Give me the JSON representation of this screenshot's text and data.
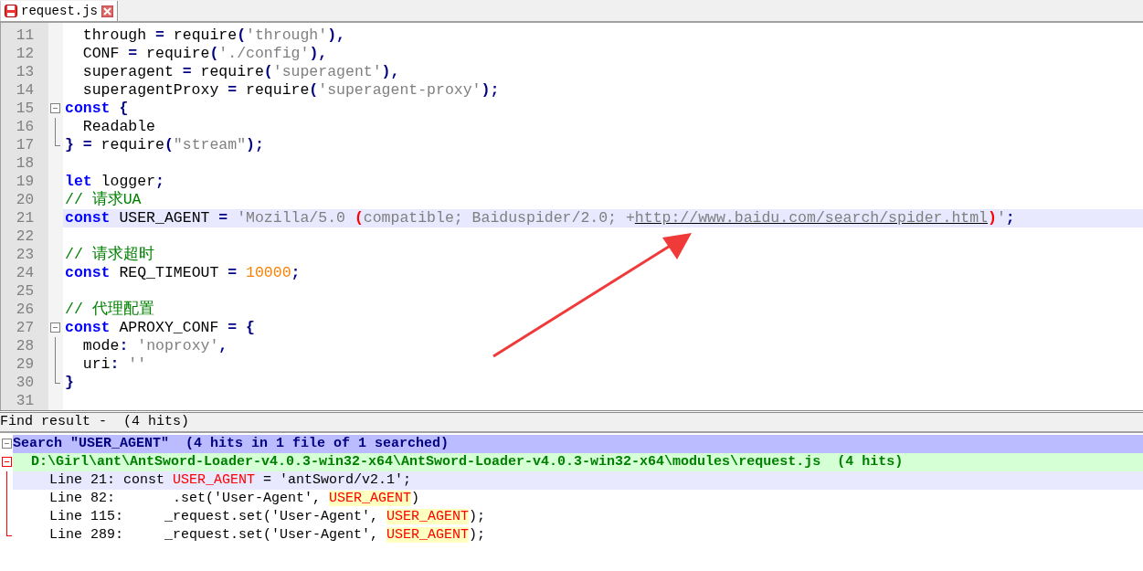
{
  "tab": {
    "title": "request.js",
    "unsaved": true
  },
  "editor": {
    "lines": [
      {
        "number": "11",
        "current": false,
        "tokens": [
          {
            "kind": "text",
            "text": "  through "
          },
          {
            "kind": "operator",
            "text": "="
          },
          {
            "kind": "text",
            "text": " require"
          },
          {
            "kind": "operator",
            "text": "("
          },
          {
            "kind": "string",
            "text": "'through'"
          },
          {
            "kind": "operator",
            "text": "),"
          }
        ]
      },
      {
        "number": "12",
        "current": false,
        "tokens": [
          {
            "kind": "text",
            "text": "  CONF "
          },
          {
            "kind": "operator",
            "text": "="
          },
          {
            "kind": "text",
            "text": " require"
          },
          {
            "kind": "operator",
            "text": "("
          },
          {
            "kind": "string",
            "text": "'./config'"
          },
          {
            "kind": "operator",
            "text": "),"
          }
        ]
      },
      {
        "number": "13",
        "current": false,
        "tokens": [
          {
            "kind": "text",
            "text": "  superagent "
          },
          {
            "kind": "operator",
            "text": "="
          },
          {
            "kind": "text",
            "text": " require"
          },
          {
            "kind": "operator",
            "text": "("
          },
          {
            "kind": "string",
            "text": "'superagent'"
          },
          {
            "kind": "operator",
            "text": "),"
          }
        ]
      },
      {
        "number": "14",
        "current": false,
        "tokens": [
          {
            "kind": "text",
            "text": "  superagentProxy "
          },
          {
            "kind": "operator",
            "text": "="
          },
          {
            "kind": "text",
            "text": " require"
          },
          {
            "kind": "operator",
            "text": "("
          },
          {
            "kind": "string",
            "text": "'superagent-proxy'"
          },
          {
            "kind": "operator",
            "text": ");"
          }
        ]
      },
      {
        "number": "15",
        "current": false,
        "fold": {
          "kind": "start"
        },
        "tokens": [
          {
            "kind": "keyword",
            "text": "const"
          },
          {
            "kind": "operator",
            "text": " {"
          }
        ]
      },
      {
        "number": "16",
        "current": false,
        "fold": {
          "kind": "mid"
        },
        "tokens": [
          {
            "kind": "text",
            "text": "  Readable"
          }
        ]
      },
      {
        "number": "17",
        "current": false,
        "fold": {
          "kind": "end"
        },
        "tokens": [
          {
            "kind": "operator",
            "text": "} ="
          },
          {
            "kind": "text",
            "text": " require"
          },
          {
            "kind": "operator",
            "text": "("
          },
          {
            "kind": "string",
            "text": "\"stream\""
          },
          {
            "kind": "operator",
            "text": ");"
          }
        ]
      },
      {
        "number": "18",
        "current": false
      },
      {
        "number": "19",
        "current": false,
        "tokens": [
          {
            "kind": "keyword",
            "text": "let"
          },
          {
            "kind": "text",
            "text": " logger"
          },
          {
            "kind": "operator",
            "text": ";"
          }
        ]
      },
      {
        "number": "20",
        "current": false,
        "tokens": [
          {
            "kind": "comment",
            "text": "// 请求UA"
          }
        ]
      },
      {
        "number": "21",
        "current": true,
        "tokens": [
          {
            "kind": "keyword",
            "text": "const"
          },
          {
            "kind": "text",
            "text": " USER_AGENT "
          },
          {
            "kind": "operator",
            "text": "="
          },
          {
            "kind": "string",
            "text": " 'Mozilla/5.0 "
          },
          {
            "kind": "brace",
            "text": "("
          },
          {
            "kind": "string",
            "text": "compatible; Baiduspider/2.0; +"
          },
          {
            "kind": "link",
            "text": "http://www.baidu.com/search/spider.html"
          },
          {
            "kind": "brace",
            "text": ")"
          },
          {
            "kind": "string",
            "text": "'"
          },
          {
            "kind": "operator",
            "text": ";"
          }
        ]
      },
      {
        "number": "22",
        "current": false
      },
      {
        "number": "23",
        "current": false,
        "tokens": [
          {
            "kind": "comment",
            "text": "// 请求超时"
          }
        ]
      },
      {
        "number": "24",
        "current": false,
        "tokens": [
          {
            "kind": "keyword",
            "text": "const"
          },
          {
            "kind": "text",
            "text": " REQ_TIMEOUT "
          },
          {
            "kind": "operator",
            "text": "="
          },
          {
            "kind": "number",
            "text": " 10000"
          },
          {
            "kind": "operator",
            "text": ";"
          }
        ]
      },
      {
        "number": "25",
        "current": false
      },
      {
        "number": "26",
        "current": false,
        "tokens": [
          {
            "kind": "comment",
            "text": "// 代理配置"
          }
        ]
      },
      {
        "number": "27",
        "current": false,
        "fold": {
          "kind": "start"
        },
        "tokens": [
          {
            "kind": "keyword",
            "text": "const"
          },
          {
            "kind": "text",
            "text": " APROXY_CONF "
          },
          {
            "kind": "operator",
            "text": "= {"
          }
        ]
      },
      {
        "number": "28",
        "current": false,
        "fold": {
          "kind": "mid"
        },
        "tokens": [
          {
            "kind": "text",
            "text": "  mode"
          },
          {
            "kind": "operator",
            "text": ":"
          },
          {
            "kind": "string",
            "text": " 'noproxy'"
          },
          {
            "kind": "operator",
            "text": ","
          }
        ]
      },
      {
        "number": "29",
        "current": false,
        "fold": {
          "kind": "mid"
        },
        "tokens": [
          {
            "kind": "text",
            "text": "  uri"
          },
          {
            "kind": "operator",
            "text": ":"
          },
          {
            "kind": "string",
            "text": " ''"
          }
        ]
      },
      {
        "number": "30",
        "current": false,
        "fold": {
          "kind": "end"
        },
        "tokens": [
          {
            "kind": "operator",
            "text": "}"
          }
        ]
      },
      {
        "number": "31",
        "current": false
      }
    ]
  },
  "find_result": {
    "title": "Find result -  (4 hits)",
    "search": "Search \"USER_AGENT\"  (4 hits in 1 file of 1 searched)",
    "file": "D:\\Girl\\ant\\AntSword-Loader-v4.0.3-win32-x64\\AntSword-Loader-v4.0.3-win32-x64\\modules\\request.js  (4 hits)",
    "hits": [
      {
        "selected": true,
        "segments": [
          {
            "kind": "text",
            "text": "Line 21: const "
          },
          {
            "kind": "match",
            "text": "USER_AGENT"
          },
          {
            "kind": "text",
            "text": " = 'antSword/v2.1';"
          }
        ]
      },
      {
        "selected": false,
        "segments": [
          {
            "kind": "text",
            "text": "Line 82:       .set('User-Agent', "
          },
          {
            "kind": "match",
            "text": "USER_AGENT"
          },
          {
            "kind": "text",
            "text": ")"
          }
        ]
      },
      {
        "selected": false,
        "segments": [
          {
            "kind": "text",
            "text": "Line 115:     _request.set('User-Agent', "
          },
          {
            "kind": "match",
            "text": "USER_AGENT"
          },
          {
            "kind": "text",
            "text": ");"
          }
        ]
      },
      {
        "selected": false,
        "segments": [
          {
            "kind": "text",
            "text": "Line 289:     _request.set('User-Agent', "
          },
          {
            "kind": "match",
            "text": "USER_AGENT"
          },
          {
            "kind": "text",
            "text": ");"
          }
        ]
      }
    ]
  }
}
